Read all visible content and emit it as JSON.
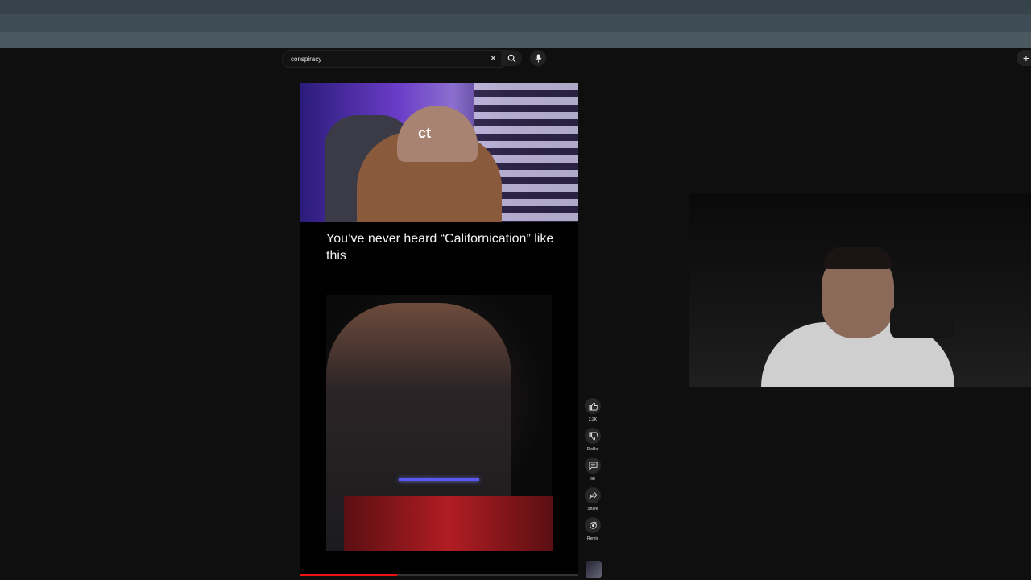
{
  "search": {
    "query": "conspiracy",
    "clear_icon": "close-icon",
    "search_icon": "search-icon",
    "mic_icon": "mic-icon"
  },
  "header": {
    "create_icon": "plus-icon"
  },
  "short": {
    "caption": "You’ve never heard “Californication” like this",
    "progress_fraction": 0.35,
    "hat_text": "ct"
  },
  "actions": [
    {
      "icon": "thumbs-up-icon",
      "label": "2.2K"
    },
    {
      "icon": "thumbs-down-icon",
      "label": "Dislike"
    },
    {
      "icon": "comment-icon",
      "label": "68"
    },
    {
      "icon": "share-icon",
      "label": "Share"
    },
    {
      "icon": "remix-icon",
      "label": "Remix"
    }
  ],
  "colors": {
    "background": "#0f0f0f",
    "progress": "#ee1111",
    "chrome": "#3e4d55"
  }
}
